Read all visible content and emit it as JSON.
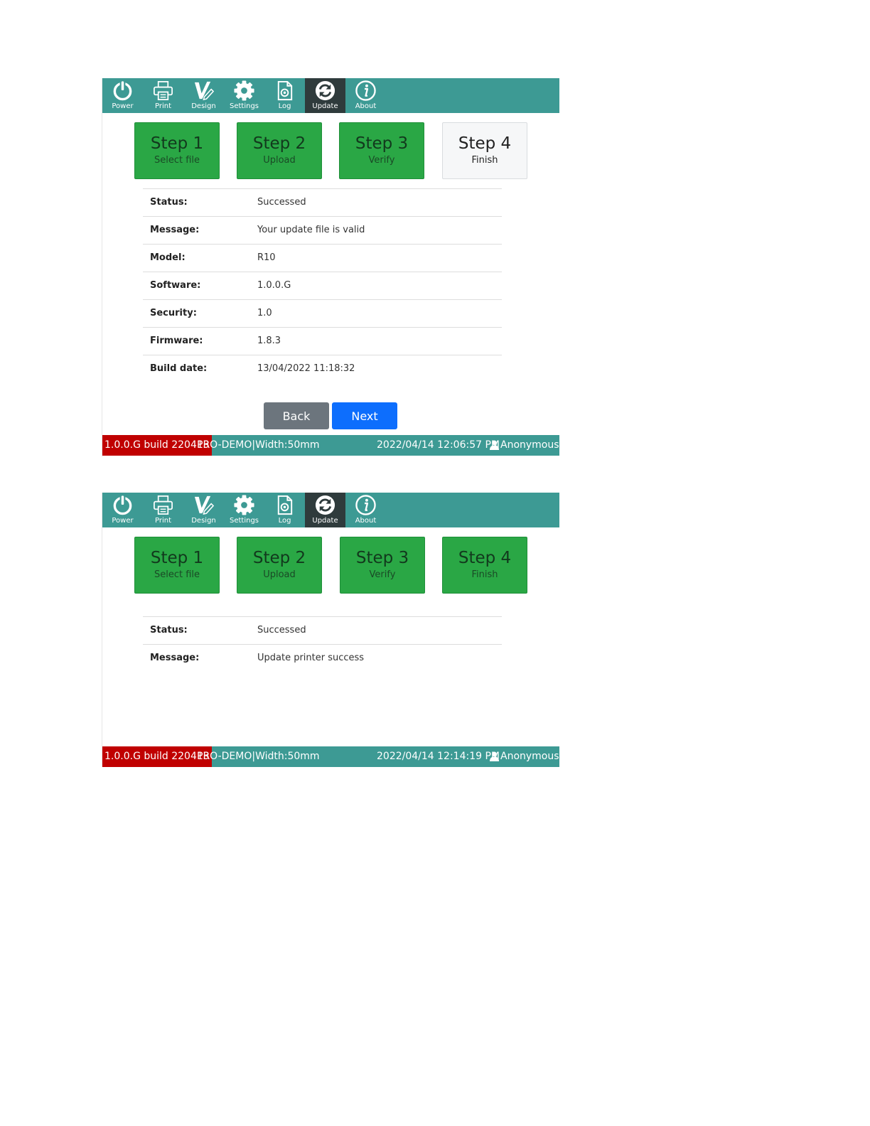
{
  "toolbar": {
    "items": [
      {
        "label": "Power",
        "icon": "power-icon"
      },
      {
        "label": "Print",
        "icon": "printer-icon"
      },
      {
        "label": "Design",
        "icon": "design-icon"
      },
      {
        "label": "Settings",
        "icon": "gear-icon"
      },
      {
        "label": "Log",
        "icon": "log-icon"
      },
      {
        "label": "Update",
        "icon": "refresh-icon",
        "active": true
      },
      {
        "label": "About",
        "icon": "info-icon"
      }
    ]
  },
  "steps": [
    {
      "title": "Step 1",
      "subtitle": "Select file"
    },
    {
      "title": "Step 2",
      "subtitle": "Upload"
    },
    {
      "title": "Step 3",
      "subtitle": "Verify"
    },
    {
      "title": "Step 4",
      "subtitle": "Finish"
    }
  ],
  "screen1": {
    "completed_steps": 3,
    "rows": [
      {
        "label": "Status:",
        "value": "Successed"
      },
      {
        "label": "Message:",
        "value": "Your update file is valid"
      },
      {
        "label": "Model:",
        "value": "R10"
      },
      {
        "label": "Software:",
        "value": "1.0.0.G"
      },
      {
        "label": "Security:",
        "value": "1.0"
      },
      {
        "label": "Firmware:",
        "value": "1.8.3"
      },
      {
        "label": "Build date:",
        "value": "13/04/2022 11:18:32"
      }
    ],
    "buttons": {
      "back": "Back",
      "next": "Next"
    },
    "statusbar": {
      "version": "1.0.0.G build 220413",
      "device": "PRO-DEMO|Width:50mm",
      "datetime": "2022/04/14 12:06:57 PM",
      "user": "Anonymous"
    }
  },
  "screen2": {
    "completed_steps": 4,
    "rows": [
      {
        "label": "Status:",
        "value": "Successed"
      },
      {
        "label": "Message:",
        "value": "Update printer success"
      }
    ],
    "statusbar": {
      "version": "1.0.0.G build 220413",
      "device": "PRO-DEMO|Width:50mm",
      "datetime": "2022/04/14 12:14:19 PM",
      "user": "Anonymous"
    }
  },
  "colors": {
    "toolbar": "#3d9a94",
    "toolbar_active": "#2f3b3c",
    "step_done": "#2aa745",
    "step_todo": "#f6f7f8",
    "version_badge": "#c00000",
    "next_button": "#0d6efd",
    "back_button": "#6c757d"
  }
}
